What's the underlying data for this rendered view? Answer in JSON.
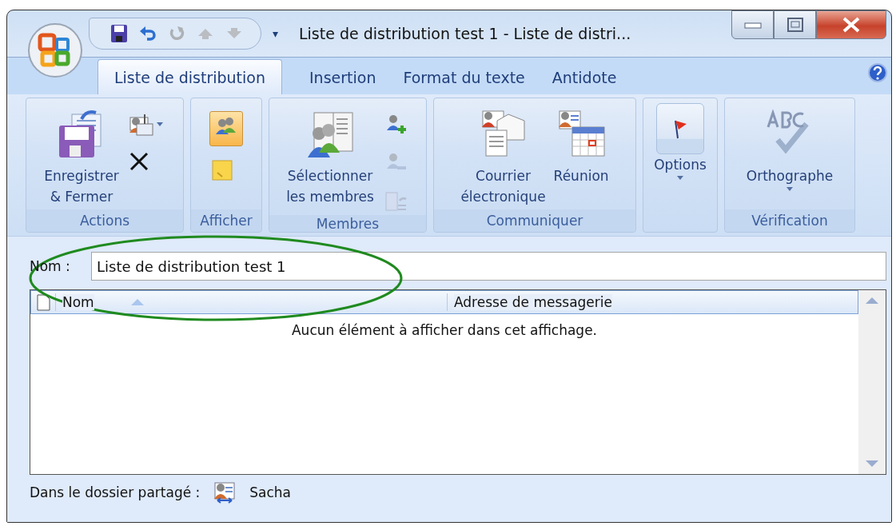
{
  "window": {
    "title": "Liste de distribution test 1  -  Liste de distri..."
  },
  "quick_access": [
    {
      "kind": "save",
      "disabled": false
    },
    {
      "kind": "undo",
      "disabled": false
    },
    {
      "kind": "redo",
      "disabled": true
    },
    {
      "kind": "up",
      "disabled": true
    },
    {
      "kind": "down",
      "disabled": true
    }
  ],
  "customize_glyph": "▾",
  "tabs": [
    {
      "label": "Liste de distribution",
      "selected": true
    },
    {
      "label": "Insertion",
      "selected": false
    },
    {
      "label": "Format du texte",
      "selected": false
    },
    {
      "label": "Antidote",
      "selected": false
    }
  ],
  "ribbon": {
    "groups": [
      {
        "label": "Actions",
        "items": [
          {
            "kind": "large",
            "label": "Enregistrer\n& Fermer"
          },
          {
            "kind": "stack",
            "items": [
              {
                "dropdown": true,
                "disabled": false
              },
              {
                "disabled": false
              }
            ]
          }
        ]
      },
      {
        "label": "Afficher",
        "items": [
          {
            "kind": "stack",
            "items": [
              {
                "selected": true,
                "disabled": false
              },
              {
                "selected": false,
                "disabled": false
              }
            ]
          }
        ]
      },
      {
        "label": "Membres",
        "items": [
          {
            "kind": "large",
            "label": "Sélectionner\nles membres"
          },
          {
            "kind": "stack",
            "items": [
              {
                "disabled": false
              },
              {
                "disabled": true
              },
              {
                "disabled": true
              }
            ]
          }
        ]
      },
      {
        "label": "Communiquer",
        "items": [
          {
            "kind": "large",
            "label": "Courrier\nélectronique"
          },
          {
            "kind": "large",
            "label": "Réunion"
          }
        ]
      },
      {
        "items": [
          {
            "kind": "large",
            "label": "Options",
            "dropdown": true,
            "boxed": true
          }
        ]
      },
      {
        "label": "Vérification",
        "items": [
          {
            "kind": "large",
            "label": "Orthographe",
            "dropdown": true
          }
        ]
      }
    ]
  },
  "name_field": {
    "label": "Nom :",
    "value": "Liste de distribution test 1"
  },
  "members_list": {
    "columns": [
      {
        "label": "Nom",
        "sorted": true
      },
      {
        "label": "Adresse de messagerie",
        "sorted": false
      }
    ],
    "empty_message": "Aucun élément à afficher dans cet affichage."
  },
  "footer": {
    "label": "Dans le dossier partagé :",
    "folder": "Sacha"
  }
}
